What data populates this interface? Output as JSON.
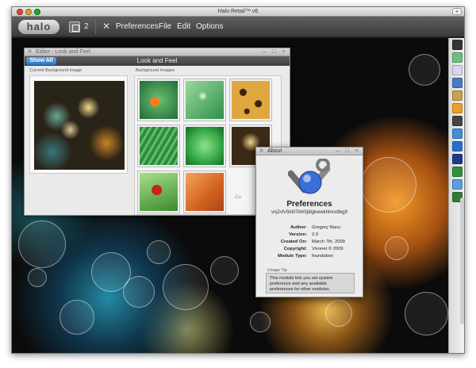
{
  "mac_window": {
    "title": "Halo Retail™ v6"
  },
  "menubar": {
    "logo": "halo",
    "window_count": "2",
    "items": [
      "Preferences",
      "File",
      "Edit",
      "Options"
    ]
  },
  "editor": {
    "title": "Editor - Look and Feel",
    "show_all": "Show All",
    "heading": "Look and Feel",
    "current_label": "Current Background Image",
    "grid_label": "Background Images",
    "partial_text": "Cu"
  },
  "about": {
    "title": "About",
    "app_name": "Preferences",
    "hash": "vnj2vfv5b6l7bh0ijdlgkwwkhlmxdbqj9",
    "fields": [
      {
        "key": "Author:",
        "value": "Gregory Nacu"
      },
      {
        "key": "Version:",
        "value": "2.0"
      },
      {
        "key": "Created On:",
        "value": "March 7th, 2009"
      },
      {
        "key": "Copyright:",
        "value": "Vivonet © 2009"
      },
      {
        "key": "Module Type:",
        "value": "foundation"
      }
    ],
    "usage_tip_label": "Usage Tip",
    "usage_tip": "This module lets you set system preference and any available preferences for other modules."
  }
}
